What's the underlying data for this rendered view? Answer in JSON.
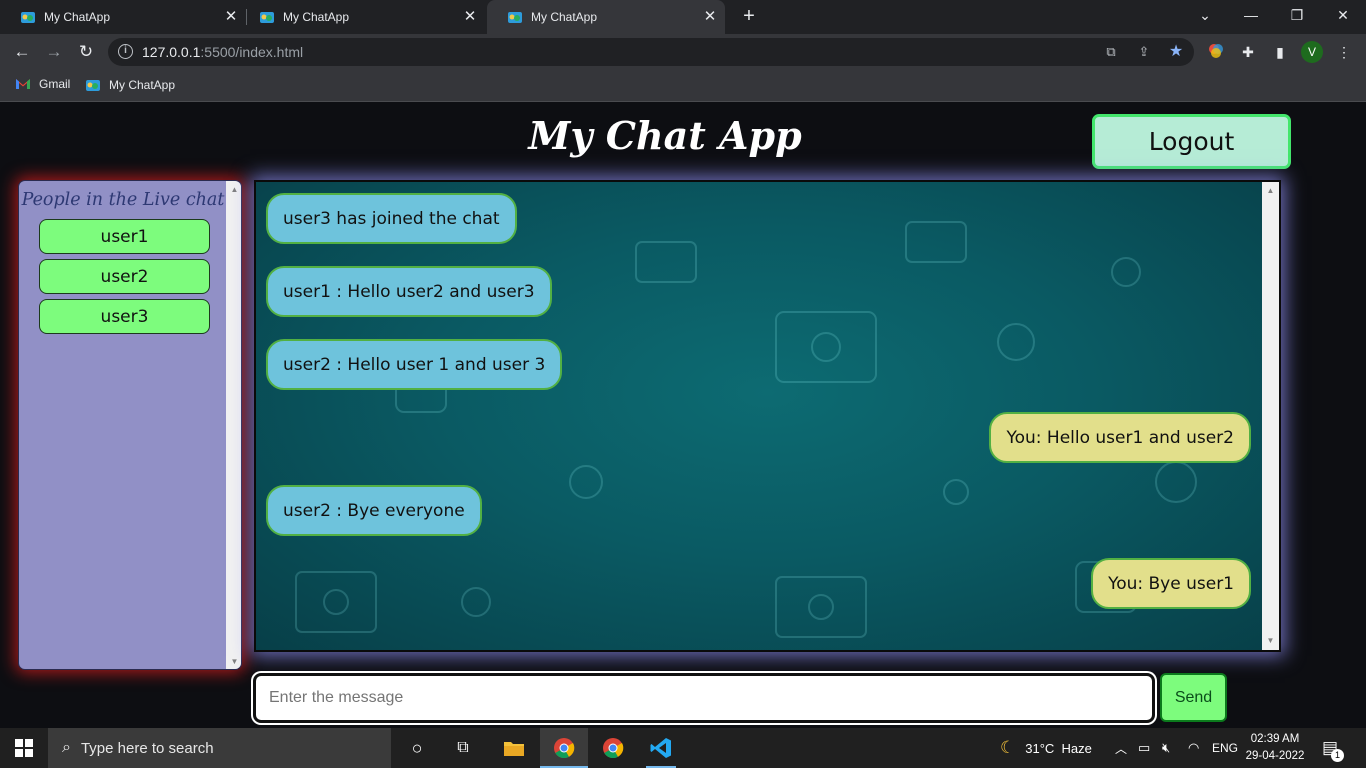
{
  "browser": {
    "tabs": [
      {
        "title": "My ChatApp"
      },
      {
        "title": "My ChatApp"
      },
      {
        "title": "My ChatApp"
      }
    ],
    "url_host": "127.0.0.1",
    "url_path": ":5500/index.html",
    "profile_initial": "V",
    "bookmarks": [
      {
        "label": "Gmail",
        "icon": "gmail-icon"
      },
      {
        "label": "My ChatApp",
        "icon": "chatapp-favicon"
      }
    ]
  },
  "app": {
    "title": "My Chat App",
    "logout_label": "Logout",
    "people_title": "People in the Live chat",
    "users": [
      "user1",
      "user2",
      "user3"
    ],
    "messages": [
      {
        "text": "user3 has joined the chat",
        "type": "in"
      },
      {
        "text": "user1 : Hello user2 and user3",
        "type": "in"
      },
      {
        "text": "user2 : Hello user 1 and user 3",
        "type": "in"
      },
      {
        "text": "You: Hello user1 and user2",
        "type": "out"
      },
      {
        "text": "user2 : Bye everyone",
        "type": "in"
      },
      {
        "text": "You: Bye user1",
        "type": "out"
      }
    ],
    "input_placeholder": "Enter the message",
    "send_label": "Send",
    "colors": {
      "incoming_bubble": "#6ec3dc",
      "outgoing_bubble": "#e2df8b",
      "user_button": "#7dfc7d",
      "people_panel": "#9190c6",
      "logout_button": "#b6ecd6"
    }
  },
  "taskbar": {
    "search_placeholder": "Type here to search",
    "weather": "31°C  Haze",
    "language": "ENG",
    "time": "02:39 AM",
    "date": "29-04-2022",
    "notification_count": "1"
  }
}
